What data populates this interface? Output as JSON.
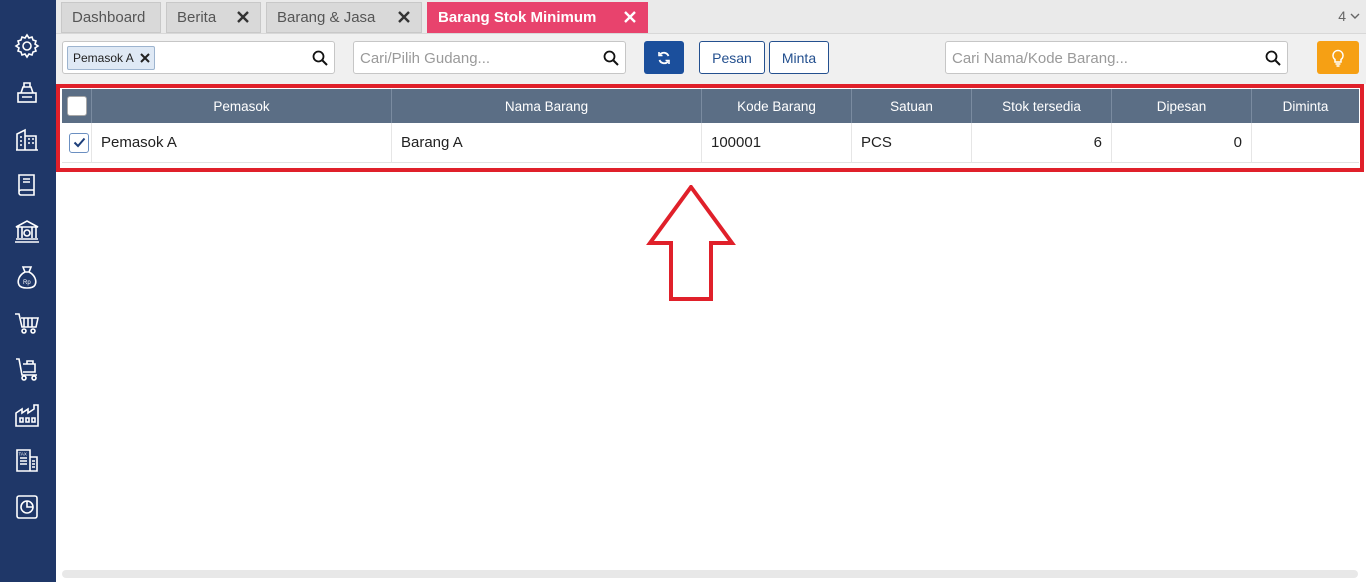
{
  "sidebar": {
    "items": [
      {
        "icon": "gear-icon"
      },
      {
        "icon": "cashier-icon"
      },
      {
        "icon": "building-icon"
      },
      {
        "icon": "book-icon"
      },
      {
        "icon": "bank-icon"
      },
      {
        "icon": "money-bag-icon"
      },
      {
        "icon": "cart-icon"
      },
      {
        "icon": "delivery-cart-icon"
      },
      {
        "icon": "factory-icon"
      },
      {
        "icon": "tax-document-icon"
      },
      {
        "icon": "report-chart-icon"
      }
    ]
  },
  "tabs": [
    {
      "label": "Dashboard",
      "closable": false
    },
    {
      "label": "Berita",
      "closable": true
    },
    {
      "label": "Barang & Jasa",
      "closable": true
    },
    {
      "label": "Barang Stok Minimum",
      "closable": true,
      "active": true
    }
  ],
  "tab_count": "4",
  "toolbar": {
    "supplier_chip": "Pemasok A",
    "warehouse_placeholder": "Cari/Pilih Gudang...",
    "pesan_label": "Pesan",
    "minta_label": "Minta",
    "item_search_placeholder": "Cari Nama/Kode Barang..."
  },
  "table": {
    "columns": [
      "Pemasok",
      "Nama Barang",
      "Kode Barang",
      "Satuan",
      "Stok tersedia",
      "Dipesan",
      "Diminta"
    ],
    "rows": [
      {
        "checked": true,
        "pemasok": "Pemasok A",
        "nama_barang": "Barang A",
        "kode_barang": "100001",
        "satuan": "PCS",
        "stok_tersedia": "6",
        "dipesan": "0",
        "diminta": ""
      }
    ]
  },
  "colors": {
    "sidebar": "#1f3768",
    "active_tab": "#e8436d",
    "grid_header": "#5b6e85",
    "primary_button": "#1b4f9c",
    "tip_button": "#f6a014",
    "annotation": "#e0202a"
  }
}
